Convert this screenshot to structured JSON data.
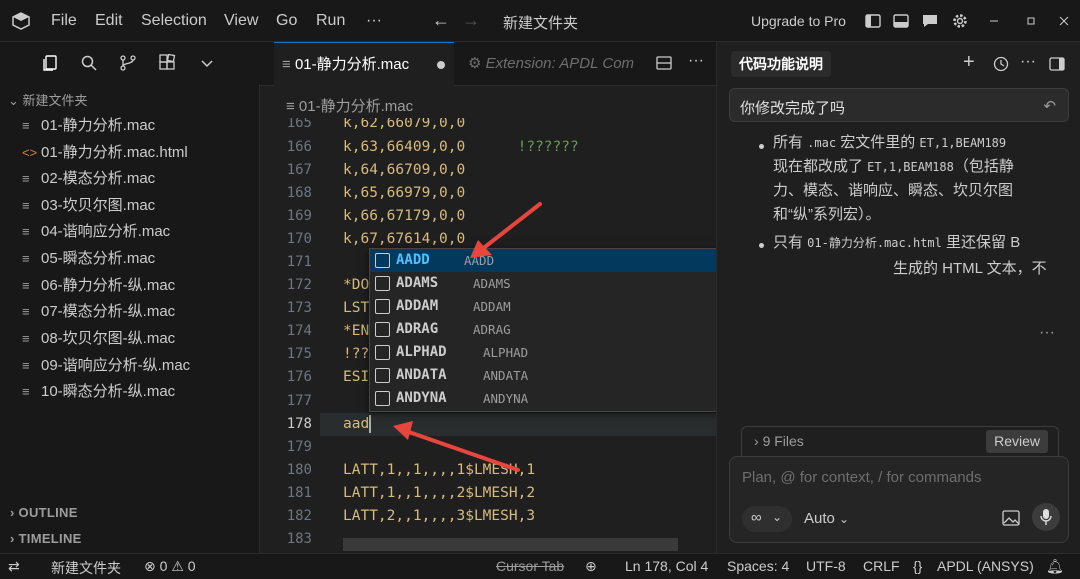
{
  "titlebar": {
    "menu": [
      "File",
      "Edit",
      "Selection",
      "View",
      "Go",
      "Run"
    ],
    "more": "···",
    "title": "新建文件夹",
    "upgrade": "Upgrade to Pro"
  },
  "sidebar": {
    "folder": "新建文件夹",
    "files": [
      {
        "icon": "≡",
        "name": "01-静力分析.mac"
      },
      {
        "icon": "<>",
        "name": "01-静力分析.mac.html"
      },
      {
        "icon": "≡",
        "name": "02-模态分析.mac"
      },
      {
        "icon": "≡",
        "name": "03-坎贝尔图.mac"
      },
      {
        "icon": "≡",
        "name": "04-谐响应分析.mac"
      },
      {
        "icon": "≡",
        "name": "05-瞬态分析.mac"
      },
      {
        "icon": "≡",
        "name": "06-静力分析-纵.mac"
      },
      {
        "icon": "≡",
        "name": "07-模态分析-纵.mac"
      },
      {
        "icon": "≡",
        "name": "08-坎贝尔图-纵.mac"
      },
      {
        "icon": "≡",
        "name": "09-谐响应分析-纵.mac"
      },
      {
        "icon": "≡",
        "name": "10-瞬态分析-纵.mac"
      }
    ],
    "outline": "OUTLINE",
    "timeline": "TIMELINE"
  },
  "tabs": [
    {
      "icon": "≡",
      "label": "01-静力分析.mac"
    },
    {
      "icon": "⚙",
      "label": "Extension: APDL Com"
    }
  ],
  "breadcrumb": "01-静力分析.mac",
  "editor": {
    "lines": [
      {
        "no": "165",
        "text": "k,62,66079,0,0",
        "comment": ""
      },
      {
        "no": "166",
        "text": "k,63,66409,0,0",
        "comment": "!??????"
      },
      {
        "no": "167",
        "text": "k,64,66709,0,0",
        "comment": ""
      },
      {
        "no": "168",
        "text": "k,65,66979,0,0",
        "comment": ""
      },
      {
        "no": "169",
        "text": "k,66,67179,0,0",
        "comment": ""
      },
      {
        "no": "170",
        "text": "k,67,67614,0,0",
        "comment": ""
      },
      {
        "no": "171",
        "text": "",
        "comment": ""
      },
      {
        "no": "172",
        "text": "*DO",
        "comment": ""
      },
      {
        "no": "173",
        "text": "LST",
        "comment": ""
      },
      {
        "no": "174",
        "text": "*EN",
        "comment": ""
      },
      {
        "no": "175",
        "text": "!??",
        "comment": ""
      },
      {
        "no": "176",
        "text": "ESI",
        "comment": ""
      },
      {
        "no": "177",
        "text": "",
        "comment": ""
      },
      {
        "no": "178",
        "text": "aad",
        "comment": ""
      },
      {
        "no": "179",
        "text": "",
        "comment": ""
      },
      {
        "no": "180",
        "text": "LATT,1,,1,,,,1$LMESH,1",
        "comment": ""
      },
      {
        "no": "181",
        "text": "LATT,1,,1,,,,2$LMESH,2",
        "comment": ""
      },
      {
        "no": "182",
        "text": "LATT,2,,1,,,,3$LMESH,3",
        "comment": ""
      },
      {
        "no": "183",
        "text": "",
        "comment": ""
      }
    ],
    "current_line": "178"
  },
  "suggestions": [
    {
      "label": "AADD",
      "detail": "AADD"
    },
    {
      "label": "ADAMS",
      "detail": "ADAMS"
    },
    {
      "label": "ADDAM",
      "detail": "ADDAM"
    },
    {
      "label": "ADRAG",
      "detail": "ADRAG"
    },
    {
      "label": "ALPHAD",
      "detail": "ALPHAD"
    },
    {
      "label": "ANDATA",
      "detail": "ANDATA"
    },
    {
      "label": "ANDYNA",
      "detail": "ANDYNA"
    }
  ],
  "right_panel": {
    "tab": "代码功能说明",
    "question": "你修改完成了吗",
    "bullet1": {
      "l1a": "所有 ",
      "l1b": ".mac",
      "l1c": " 宏文件里的 ",
      "l1d": "ET,1,BEAM189",
      "l2a": "现在都改成了 ",
      "l2b": "ET,1,BEAM188",
      "l2c": "（包括静",
      "l3": "力、模态、谐响应、瞬态、坎贝尔图",
      "l4": "和“纵”系列宏）。"
    },
    "bullet2": {
      "l1a": "只有 ",
      "l1b": "01-静力分析.mac.html",
      "l1c": " 里还保留 B",
      "l2": "生成的 HTML 文本，不"
    },
    "files": "9 Files",
    "review": "Review",
    "input_placeholder": "Plan, @ for context, / for commands",
    "model": "Auto"
  },
  "statusbar": {
    "folder": "新建文件夹",
    "errors": "0",
    "warnings": "0",
    "cursor_tab": "Cursor Tab",
    "position": "Ln 178, Col 4",
    "spaces": "Spaces: 4",
    "encoding": "UTF-8",
    "eol": "CRLF",
    "braces": "{}",
    "language": "APDL (ANSYS)"
  },
  "colors": {
    "accent": "#0078d4",
    "arrow": "#e8453c",
    "keyword_yellow": "#d7ba7d",
    "suggest_highlight": "#4fc1ff"
  }
}
